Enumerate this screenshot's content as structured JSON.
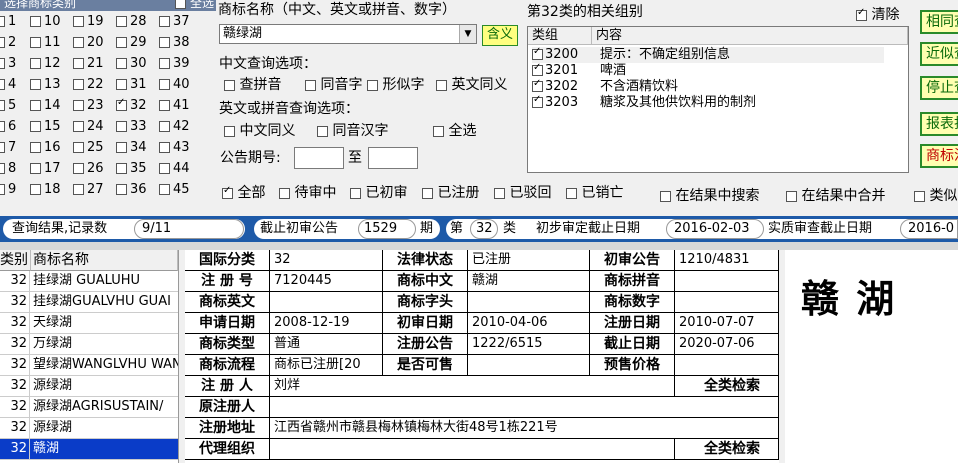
{
  "class_panel": {
    "title": "选择商标类别",
    "all_label": "全选",
    "classes": [
      {
        "n": "1",
        "on": false
      },
      {
        "n": "2",
        "on": false
      },
      {
        "n": "3",
        "on": false
      },
      {
        "n": "4",
        "on": false
      },
      {
        "n": "5",
        "on": false
      },
      {
        "n": "6",
        "on": false
      },
      {
        "n": "7",
        "on": false
      },
      {
        "n": "8",
        "on": false
      },
      {
        "n": "9",
        "on": false
      },
      {
        "n": "10",
        "on": false
      },
      {
        "n": "11",
        "on": false
      },
      {
        "n": "12",
        "on": false
      },
      {
        "n": "13",
        "on": false
      },
      {
        "n": "14",
        "on": false
      },
      {
        "n": "15",
        "on": false
      },
      {
        "n": "16",
        "on": false
      },
      {
        "n": "17",
        "on": false
      },
      {
        "n": "18",
        "on": false
      },
      {
        "n": "19",
        "on": false
      },
      {
        "n": "20",
        "on": false
      },
      {
        "n": "21",
        "on": false
      },
      {
        "n": "22",
        "on": false
      },
      {
        "n": "23",
        "on": false
      },
      {
        "n": "24",
        "on": false
      },
      {
        "n": "25",
        "on": false
      },
      {
        "n": "26",
        "on": false
      },
      {
        "n": "27",
        "on": false
      },
      {
        "n": "28",
        "on": false
      },
      {
        "n": "29",
        "on": false
      },
      {
        "n": "30",
        "on": false
      },
      {
        "n": "31",
        "on": false
      },
      {
        "n": "32",
        "on": true
      },
      {
        "n": "33",
        "on": false
      },
      {
        "n": "34",
        "on": false
      },
      {
        "n": "35",
        "on": false
      },
      {
        "n": "36",
        "on": false
      },
      {
        "n": "37",
        "on": false
      },
      {
        "n": "38",
        "on": false
      },
      {
        "n": "39",
        "on": false
      },
      {
        "n": "40",
        "on": false
      },
      {
        "n": "41",
        "on": false
      },
      {
        "n": "42",
        "on": false
      },
      {
        "n": "43",
        "on": false
      },
      {
        "n": "44",
        "on": false
      },
      {
        "n": "45",
        "on": false
      }
    ]
  },
  "search": {
    "name_label": "商标名称（中文、英文或拼音、数字）",
    "name_value": "赣绿湖",
    "meaning_button": "含义",
    "cn_options_label": "中文查询选项：",
    "cn_options": [
      "查拼音",
      "同音字",
      "形似字",
      "英文同义"
    ],
    "en_options_label": "英文或拼音查询选项：",
    "en_options": [
      "中文同义",
      "同音汉字",
      "全选"
    ],
    "period_label": "公告期号:",
    "period_to": "至",
    "period_from_value": "",
    "period_to_value": ""
  },
  "groups": {
    "title": "第32类的相关组别",
    "clear_label": "清除",
    "col_group": "类组",
    "col_content": "内容",
    "rows": [
      {
        "code": "3200",
        "text": "提示：不确定组别信息"
      },
      {
        "code": "3201",
        "text": "啤酒"
      },
      {
        "code": "3202",
        "text": "不含酒精饮料"
      },
      {
        "code": "3203",
        "text": "糖浆及其他供饮料用的制剂"
      }
    ]
  },
  "right_buttons": [
    "相同查",
    "近似查",
    "停止查",
    "报表打",
    "商标注"
  ],
  "status_filters": {
    "items": [
      {
        "label": "全部",
        "on": true
      },
      {
        "label": "待审中",
        "on": false
      },
      {
        "label": "已初审",
        "on": false
      },
      {
        "label": "已注册",
        "on": false
      },
      {
        "label": "已驳回",
        "on": false
      },
      {
        "label": "已销亡",
        "on": false
      }
    ],
    "search_in_results": "在结果中搜索",
    "merge_in_results": "在结果中合并",
    "similar": "类似"
  },
  "info_bar": {
    "result_label": "查询结果,记录数",
    "result_value": "9/11",
    "cutoff_label": "截止初审公告",
    "cutoff_value": "1529",
    "period_unit": "期",
    "class_prefix": "第",
    "class_value": "32",
    "class_suffix": "类",
    "prelim_label": "初步审定截止日期",
    "prelim_value": "2016-02-03",
    "subst_label": "实质审查截止日期",
    "subst_value": "2016-0"
  },
  "results": {
    "col_class": "类别",
    "col_name": "商标名称",
    "rows": [
      {
        "n": "32",
        "name": "挂绿湖 GUALUHU",
        "sel": false
      },
      {
        "n": "32",
        "name": "挂绿湖GUALVHU GUAI",
        "sel": false
      },
      {
        "n": "32",
        "name": "天绿湖",
        "sel": false
      },
      {
        "n": "32",
        "name": "万绿湖",
        "sel": false
      },
      {
        "n": "32",
        "name": "望绿湖WANGLVHU WAN",
        "sel": false
      },
      {
        "n": "32",
        "name": "源绿湖",
        "sel": false
      },
      {
        "n": "32",
        "name": "源绿湖AGRISUSTAIN/",
        "sel": false
      },
      {
        "n": "32",
        "name": "源绿湖",
        "sel": false
      },
      {
        "n": "32",
        "name": "赣湖",
        "sel": true
      }
    ]
  },
  "detail": {
    "intl_class_k": "国际分类",
    "intl_class_v": "32",
    "legal_k": "法律状态",
    "legal_v": "已注册",
    "prelim_pub_k": "初审公告",
    "prelim_pub_v": "1210/4831",
    "reg_no_k": "注 册 号",
    "reg_no_v": "7120445",
    "cn_k": "商标中文",
    "cn_v": "赣湖",
    "pinyin_k": "商标拼音",
    "pinyin_v": "",
    "en_k": "商标英文",
    "en_v": "",
    "head_k": "商标字头",
    "head_v": "",
    "num_k": "商标数字",
    "num_v": "",
    "apply_k": "申请日期",
    "apply_v": "2008-12-19",
    "prelim_date_k": "初审日期",
    "prelim_date_v": "2010-04-06",
    "reg_date_k": "注册日期",
    "reg_date_v": "2010-07-07",
    "type_k": "商标类型",
    "type_v": "普通",
    "reg_pub_k": "注册公告",
    "reg_pub_v": "1222/6515",
    "expire_k": "截止日期",
    "expire_v": "2020-07-06",
    "flow_k": "商标流程",
    "flow_v": "商标已注册[20",
    "sellable_k": "是否可售",
    "sellable_v": "",
    "price_k": "预售价格",
    "price_v": "",
    "registrant_k": "注 册 人",
    "registrant_v": "刘烊",
    "full_search_1": "全类检索",
    "orig_reg_k": "原注册人",
    "orig_reg_v": "",
    "address_k": "注册地址",
    "address_v": "江西省赣州市赣县梅林镇梅林大街48号1栋221号",
    "agent_k": "代理组织",
    "agent_v": "",
    "full_search_2": "全类检索"
  },
  "preview": {
    "mark_text": "赣 湖"
  }
}
